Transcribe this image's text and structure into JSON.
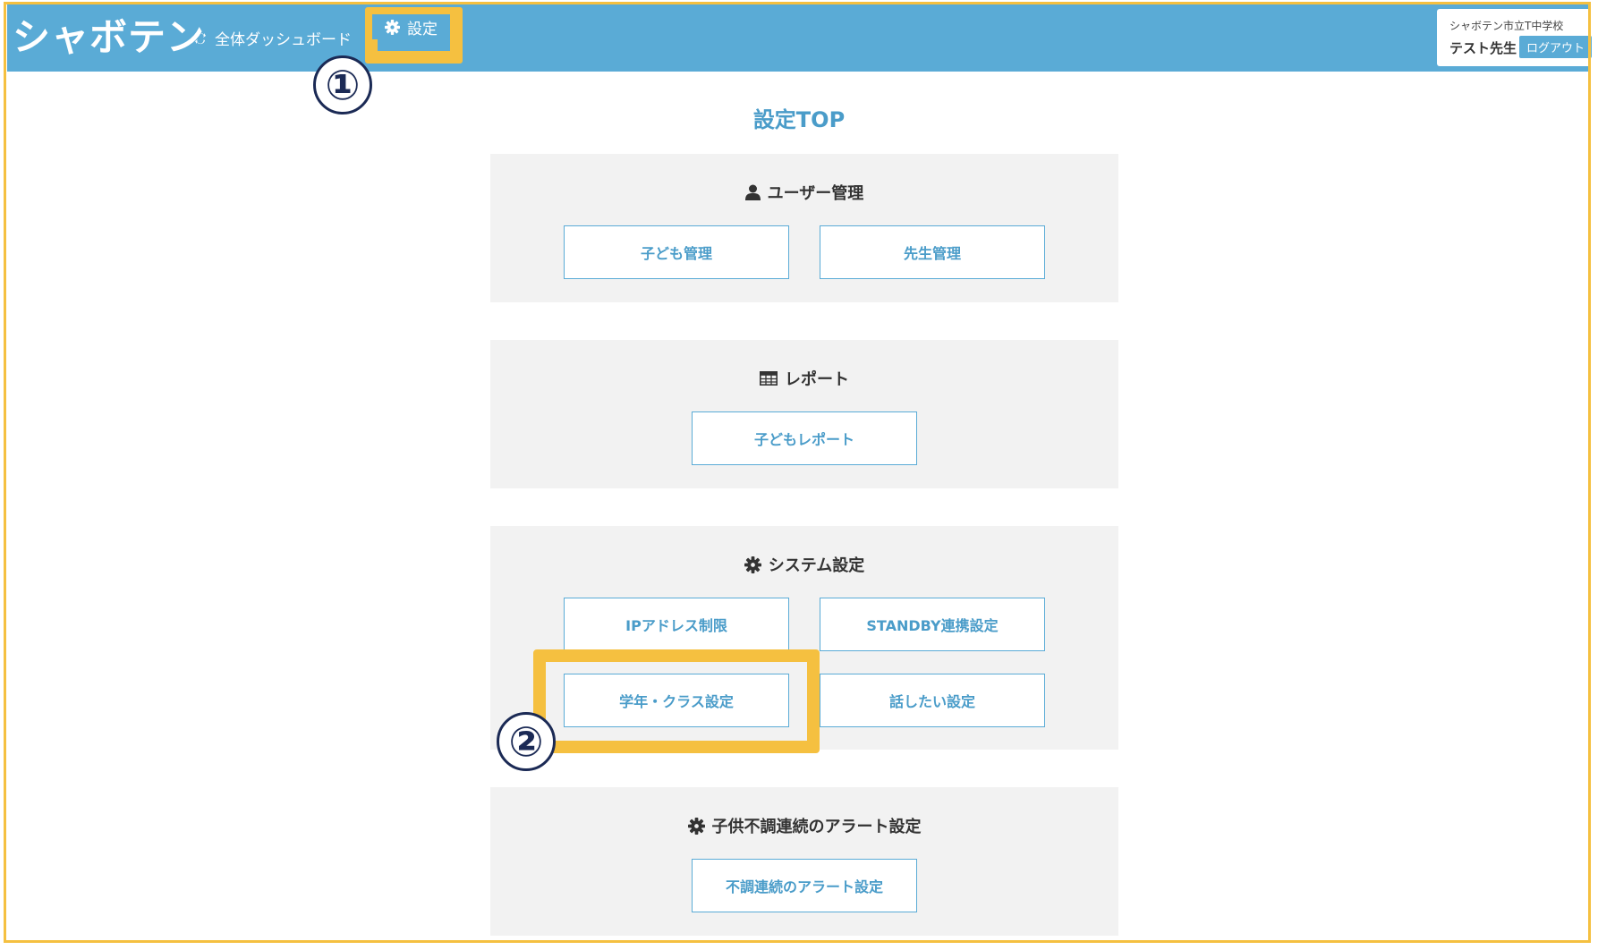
{
  "header": {
    "logo": "シャボテン",
    "nav": {
      "dashboard": "全体ダッシュボード",
      "settings": "設定"
    },
    "user": {
      "school": "シャボテン市立T中学校",
      "teacher": "テスト先生",
      "logout": "ログアウト"
    }
  },
  "annotations": {
    "marker1": "①",
    "marker2": "②",
    "highlight_color": "#f5c040"
  },
  "page": {
    "title": "設定TOP"
  },
  "sections": {
    "user_mgmt": {
      "title": "ユーザー管理",
      "buttons": [
        "子ども管理",
        "先生管理"
      ]
    },
    "report": {
      "title": "レポート",
      "buttons": [
        "子どもレポート"
      ]
    },
    "system": {
      "title": "システム設定",
      "buttons": [
        "IPアドレス制限",
        "STANDBY連携設定",
        "学年・クラス設定",
        "話したい設定"
      ]
    },
    "alert": {
      "title": "子供不調連続のアラート設定",
      "buttons": [
        "不調連続のアラート設定"
      ]
    }
  },
  "colors": {
    "header_bg": "#5aabd6",
    "accent_text": "#4a9cc9",
    "card_bg": "#f2f2f2",
    "marker": "#1b2a55"
  },
  "icons": {
    "dashboard": "refresh-icon",
    "settings": "gear-icon",
    "user_mgmt": "user-icon",
    "report": "table-icon",
    "system": "gear-icon",
    "alert": "gear-icon"
  }
}
